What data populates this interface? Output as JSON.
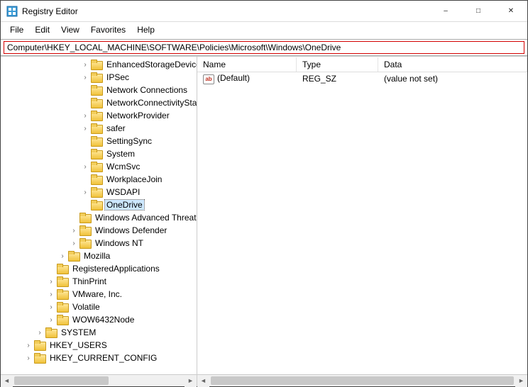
{
  "window": {
    "title": "Registry Editor"
  },
  "menu": {
    "file": "File",
    "edit": "Edit",
    "view": "View",
    "favorites": "Favorites",
    "help": "Help"
  },
  "address": "Computer\\HKEY_LOCAL_MACHINE\\SOFTWARE\\Policies\\Microsoft\\Windows\\OneDrive",
  "tree": {
    "level7": [
      {
        "label": "EnhancedStorageDevices",
        "expander": "collapsed"
      },
      {
        "label": "IPSec",
        "expander": "collapsed"
      },
      {
        "label": "Network Connections",
        "expander": "none"
      },
      {
        "label": "NetworkConnectivityStatusIndicator",
        "expander": "none"
      },
      {
        "label": "NetworkProvider",
        "expander": "collapsed"
      },
      {
        "label": "safer",
        "expander": "collapsed"
      },
      {
        "label": "SettingSync",
        "expander": "none"
      },
      {
        "label": "System",
        "expander": "none"
      },
      {
        "label": "WcmSvc",
        "expander": "collapsed"
      },
      {
        "label": "WorkplaceJoin",
        "expander": "none"
      },
      {
        "label": "WSDAPI",
        "expander": "collapsed"
      },
      {
        "label": "OneDrive",
        "expander": "none",
        "selected": true
      }
    ],
    "level6": [
      {
        "label": "Windows Advanced Threat Protection",
        "expander": "none"
      },
      {
        "label": "Windows Defender",
        "expander": "collapsed"
      },
      {
        "label": "Windows NT",
        "expander": "collapsed"
      }
    ],
    "level5": [
      {
        "label": "Mozilla",
        "expander": "collapsed"
      }
    ],
    "level4": [
      {
        "label": "RegisteredApplications",
        "expander": "none"
      },
      {
        "label": "ThinPrint",
        "expander": "collapsed"
      },
      {
        "label": "VMware, Inc.",
        "expander": "collapsed"
      },
      {
        "label": "Volatile",
        "expander": "collapsed"
      },
      {
        "label": "WOW6432Node",
        "expander": "collapsed"
      }
    ],
    "level3": [
      {
        "label": "SYSTEM",
        "expander": "collapsed"
      }
    ],
    "level2": [
      {
        "label": "HKEY_USERS",
        "expander": "collapsed"
      },
      {
        "label": "HKEY_CURRENT_CONFIG",
        "expander": "collapsed"
      }
    ]
  },
  "list": {
    "headers": {
      "name": "Name",
      "type": "Type",
      "data": "Data"
    },
    "rows": [
      {
        "icon": "ab",
        "name": "(Default)",
        "type": "REG_SZ",
        "data": "(value not set)"
      }
    ]
  }
}
